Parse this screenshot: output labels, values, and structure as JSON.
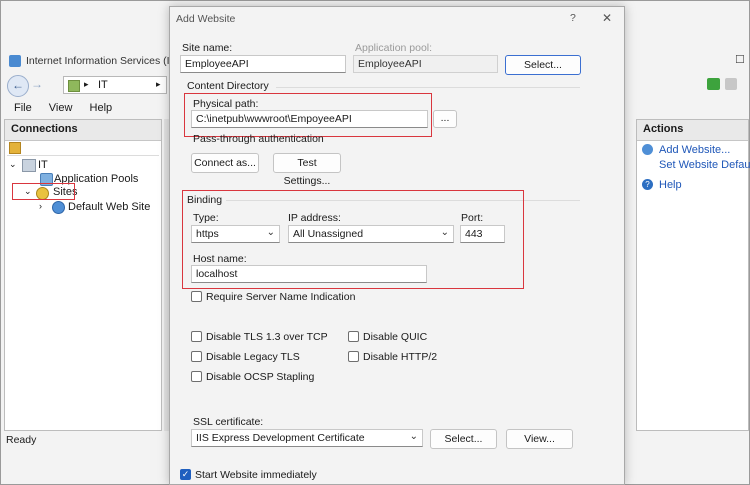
{
  "iis": {
    "title": "Internet Information Services (IIS) M",
    "address": "IT",
    "menu": [
      "File",
      "View",
      "Help"
    ],
    "connections_title": "Connections",
    "tree": {
      "root": "IT",
      "app_pools": "Application Pools",
      "sites": "Sites",
      "default_site": "Default Web Site"
    },
    "actions_title": "Actions",
    "actions": {
      "add_website": "Add Website...",
      "set_defaults": "Set Website Defaults...",
      "help": "Help"
    },
    "status": "Ready"
  },
  "dialog": {
    "title": "Add Website",
    "help_glyph": "?",
    "close_glyph": "✕",
    "site_name_label": "Site name:",
    "site_name_value": "EmployeeAPI",
    "app_pool_label": "Application pool:",
    "app_pool_value": "EmployeeAPI",
    "select_button": "Select...",
    "content_directory_label": "Content Directory",
    "physical_path_label": "Physical path:",
    "physical_path_value": "C:\\inetpub\\wwwroot\\EmpoyeeAPI",
    "browse_button": "...",
    "passthrough_label": "Pass-through authentication",
    "connect_as_button": "Connect as...",
    "test_settings_button": "Test Settings...",
    "binding_label": "Binding",
    "type_label": "Type:",
    "type_value": "https",
    "ip_label": "IP address:",
    "ip_value": "All Unassigned",
    "port_label": "Port:",
    "port_value": "443",
    "host_label": "Host name:",
    "host_value": "localhost",
    "sni_label": "Require Server Name Indication",
    "tls13_label": "Disable TLS 1.3 over TCP",
    "quic_label": "Disable QUIC",
    "legacy_tls_label": "Disable Legacy TLS",
    "http2_label": "Disable HTTP/2",
    "ocsp_label": "Disable OCSP Stapling",
    "ssl_label": "SSL certificate:",
    "ssl_value": "IIS Express Development Certificate",
    "ssl_select_button": "Select...",
    "view_button": "View...",
    "start_label": "Start Website immediately",
    "start_checked": true
  },
  "colors": {
    "annotation": "#d9363e",
    "link": "#1f57b8",
    "checkbox": "#1f5fbf"
  }
}
